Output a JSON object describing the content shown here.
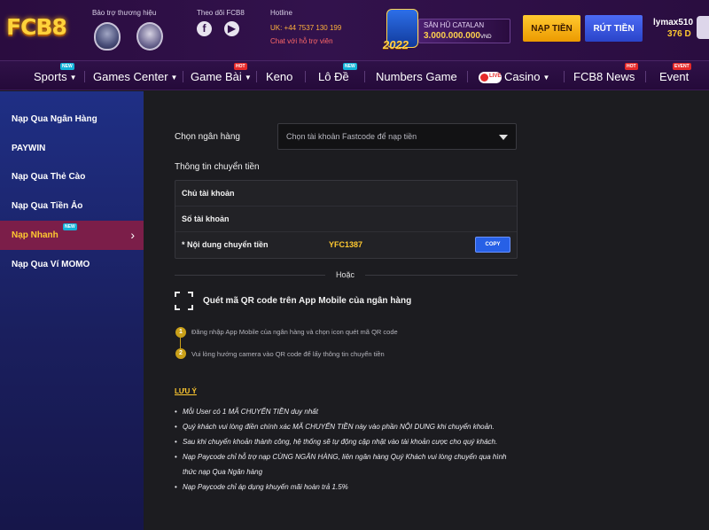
{
  "brand": {
    "logo_text": "FCB8",
    "sponsor_label": "Bảo trợ thương hiệu",
    "follow_label": "Theo dõi FCB8",
    "hotline_label": "Hotline",
    "hotline_number": "UK: +44 7537 130 199",
    "support_chat": "Chat với hỗ trợ viên"
  },
  "jackpot": {
    "event_year": "2022",
    "title": "SĂN HŨ CATALAN",
    "amount": "3.000.000.000",
    "currency": "VND"
  },
  "header": {
    "deposit_button": "NẠP TIỀN",
    "withdraw_button": "RÚT TIỀN",
    "username": "lymax510",
    "balance": "376 D"
  },
  "nav": {
    "items": [
      {
        "label": "Sports",
        "badge": "NEW"
      },
      {
        "label": "Games Center",
        "badge": ""
      },
      {
        "label": "Game Bài",
        "badge": "HOT"
      },
      {
        "label": "Keno",
        "badge": ""
      },
      {
        "label": "Lô Đề",
        "badge": "NEW"
      },
      {
        "label": "Numbers Game",
        "badge": ""
      },
      {
        "label": "Casino",
        "badge": "",
        "live": "LIVE"
      },
      {
        "label": "FCB8 News",
        "badge": "HOT"
      },
      {
        "label": "Event",
        "badge": "EVENT"
      }
    ]
  },
  "sidebar": {
    "items": [
      {
        "label": "Nạp Qua Ngân Hàng"
      },
      {
        "label": "PAYWIN"
      },
      {
        "label": "Nạp Qua Thẻ Cào"
      },
      {
        "label": "Nạp Qua Tiền Ảo"
      },
      {
        "label": "Nạp Nhanh",
        "badge": "NEW",
        "active": true
      },
      {
        "label": "Nạp Qua Ví MOMO"
      }
    ]
  },
  "form": {
    "bank_label": "Chọn ngân hàng",
    "bank_select_value": "Chọn tài khoản Fastcode để nạp tiền",
    "transfer_info_title": "Thông tin chuyển tiền",
    "account_holder_label": "Chủ tài khoản",
    "account_number_label": "Số tài khoản",
    "transfer_content_label": "* Nội dung chuyển tiền",
    "transfer_content_value": "YFC1387",
    "copy_button": "COPY",
    "or_text": "Hoặc",
    "qr_title": "Quét mã QR code trên App Mobile của ngân hàng",
    "steps": [
      {
        "num": "1",
        "text": "Đăng nhập App Mobile của ngân hàng và chọn icon quét mã QR code"
      },
      {
        "num": "2",
        "text": "Vui lòng hướng camera vào QR code để lấy thông tin chuyển tiền"
      }
    ]
  },
  "notes": {
    "title": "LƯU Ý",
    "items": [
      "Mỗi User có 1 MÃ CHUYỂN TIỀN duy nhất",
      "Quý khách vui lòng điền chính xác MÃ CHUYỂN TIỀN này vào phần NỘI DUNG khi chuyển khoản.",
      "Sau khi chuyển khoản thành công, hệ thống sẽ tự động cập nhật vào tài khoản cược cho quý khách.",
      "Nạp Paycode chỉ hỗ trợ nạp CÙNG NGÂN HÀNG, liên ngân hàng Quý Khách vui lòng chuyển qua hình thức nạp Qua Ngân hàng",
      "Nạp Paycode chỉ áp dụng khuyến mãi hoàn trả 1.5%"
    ]
  },
  "colors": {
    "accent_gold": "#ffc930",
    "accent_blue": "#2760e6",
    "sidebar_active": "#7b1e49",
    "header_bg": "#32124c"
  },
  "icons": {
    "club_crest_1": "shield-crest-icon",
    "club_crest_2": "round-crest-icon",
    "facebook": "facebook-icon",
    "youtube": "youtube-icon",
    "qr": "qr-scan-icon",
    "chevron": "chevron-right-icon"
  }
}
